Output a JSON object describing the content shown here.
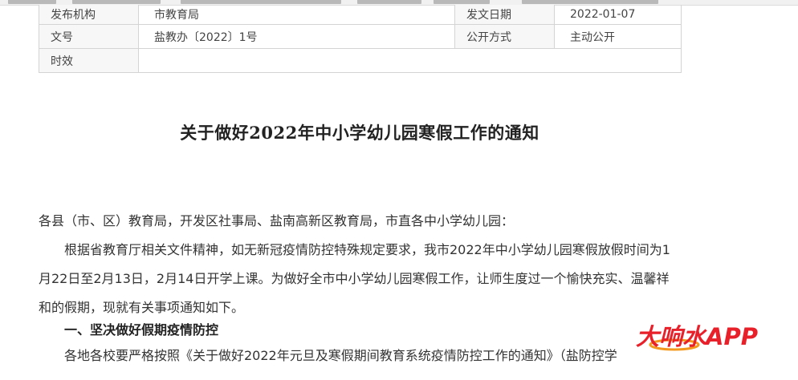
{
  "meta": {
    "rows": [
      {
        "label1": "发布机构",
        "value1": "市教育局",
        "label2": "发文日期",
        "value2": "2022-01-07"
      },
      {
        "label1": "文号",
        "value1": "盐教办〔2022〕1号",
        "label2": "公开方式",
        "value2": "主动公开"
      },
      {
        "label1": "时效",
        "value1": ""
      }
    ]
  },
  "document": {
    "title": "关于做好2022年中小学幼儿园寒假工作的通知",
    "salutation": "各县（市、区）教育局，开发区社事局、盐南高新区教育局，市直各中小学幼儿园：",
    "paragraph1": "根据省教育厅相关文件精神，如无新冠疫情防控特殊规定要求，我市2022年中小学幼儿园寒假放假时间为1月22日至2月13日，2月14日开学上课。为做好全市中小学幼儿园寒假工作，让师生度过一个愉快充实、温馨祥和的假期，现就有关事项通知如下。",
    "heading1": "一、坚决做好假期疫情防控",
    "paragraph2": "各地各校要严格按照《关于做好2022年元旦及寒假期间教育系统疫情防控工作的通知》（盐防控学"
  },
  "watermark": {
    "text": "大响水APP",
    "colors": {
      "red": "#e8202a",
      "orange": "#f39a1e"
    }
  }
}
